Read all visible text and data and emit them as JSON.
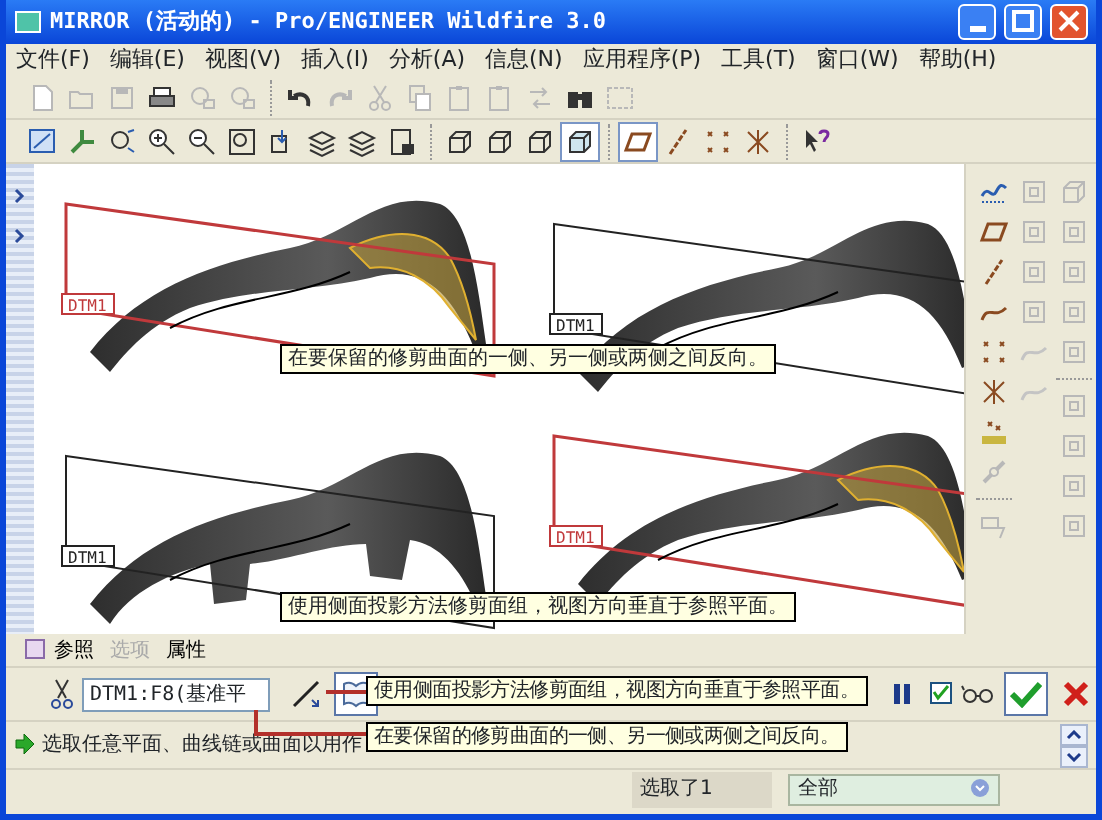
{
  "window": {
    "title": "MIRROR (活动的) - Pro/ENGINEER Wildfire 3.0"
  },
  "menu": [
    "文件(F)",
    "编辑(E)",
    "视图(V)",
    "插入(I)",
    "分析(A)",
    "信息(N)",
    "应用程序(P)",
    "工具(T)",
    "窗口(W)",
    "帮助(H)"
  ],
  "toolbar_1": [
    {
      "kind": "new-file",
      "disabled": true
    },
    {
      "kind": "folder",
      "disabled": true
    },
    {
      "kind": "save",
      "disabled": true
    },
    {
      "kind": "printer",
      "disabled": false
    },
    {
      "kind": "envelope",
      "disabled": true
    },
    {
      "kind": "envelope",
      "disabled": true
    },
    {
      "kind": "sep"
    },
    {
      "kind": "undo",
      "disabled": false
    },
    {
      "kind": "redo",
      "disabled": true
    },
    {
      "kind": "scissors",
      "disabled": true
    },
    {
      "kind": "copy",
      "disabled": true
    },
    {
      "kind": "paste",
      "disabled": true
    },
    {
      "kind": "paste",
      "disabled": true
    },
    {
      "kind": "regenerate",
      "disabled": true
    },
    {
      "kind": "binoculars",
      "disabled": false
    },
    {
      "kind": "selection-box",
      "disabled": true
    }
  ],
  "toolbar_2": [
    {
      "kind": "monitor",
      "selected": false
    },
    {
      "kind": "tripod",
      "selected": false
    },
    {
      "kind": "orient",
      "selected": false
    },
    {
      "kind": "zoom-in",
      "selected": false
    },
    {
      "kind": "zoom-out",
      "selected": false
    },
    {
      "kind": "zoom-fit",
      "selected": false
    },
    {
      "kind": "box-arrow",
      "selected": false
    },
    {
      "kind": "layers",
      "selected": false
    },
    {
      "kind": "layers",
      "selected": false
    },
    {
      "kind": "sheet",
      "selected": false
    },
    {
      "kind": "sep"
    },
    {
      "kind": "cube",
      "selected": false
    },
    {
      "kind": "cube",
      "selected": false
    },
    {
      "kind": "cube",
      "selected": false
    },
    {
      "kind": "cube-shaded",
      "selected": true
    },
    {
      "kind": "sep"
    },
    {
      "kind": "datum-plane",
      "selected": true
    },
    {
      "kind": "datum-axis",
      "selected": false
    },
    {
      "kind": "datum-points",
      "selected": false
    },
    {
      "kind": "csys",
      "selected": false
    },
    {
      "kind": "sep"
    },
    {
      "kind": "help-cursor",
      "selected": false
    }
  ],
  "right_toolbar": [
    [
      {
        "kind": "sketch-curve",
        "disabled": false
      },
      {
        "kind": "datum-plane",
        "disabled": false
      },
      {
        "kind": "datum-axis",
        "disabled": false
      },
      {
        "kind": "curve",
        "disabled": false
      },
      {
        "kind": "datum-points",
        "disabled": false
      },
      {
        "kind": "csys",
        "disabled": false
      },
      {
        "kind": "analysis",
        "disabled": false
      },
      {
        "kind": "chain",
        "disabled": true
      },
      {
        "kind": "sep"
      },
      {
        "kind": "sketch",
        "disabled": true
      }
    ],
    [
      {
        "kind": "generic",
        "disabled": true
      },
      {
        "kind": "generic",
        "disabled": true
      },
      {
        "kind": "generic",
        "disabled": true
      },
      {
        "kind": "generic",
        "disabled": true
      },
      {
        "kind": "curve",
        "disabled": true
      },
      {
        "kind": "curve",
        "disabled": true
      }
    ],
    [
      {
        "kind": "cube",
        "disabled": true
      },
      {
        "kind": "generic",
        "disabled": true
      },
      {
        "kind": "generic",
        "disabled": true
      },
      {
        "kind": "generic",
        "disabled": true
      },
      {
        "kind": "generic",
        "disabled": true
      },
      {
        "kind": "sep"
      },
      {
        "kind": "generic",
        "disabled": true
      },
      {
        "kind": "generic",
        "disabled": true
      },
      {
        "kind": "generic",
        "disabled": true
      },
      {
        "kind": "generic",
        "disabled": true
      }
    ]
  ],
  "canvas": {
    "figures": [
      {
        "kind": "wave",
        "label": "DTM1",
        "highlighted": true
      },
      {
        "kind": "wave",
        "label": "DTM1",
        "highlighted": false
      },
      {
        "kind": "notched",
        "label": "DTM1",
        "highlighted": false
      },
      {
        "kind": "wave",
        "label": "DTM1",
        "highlighted": true
      }
    ],
    "tips": [
      "在要保留的修剪曲面的一侧、另一侧或两侧之间反向。",
      "使用侧面投影方法修剪面组，视图方向垂直于参照平面。"
    ]
  },
  "dashboard": {
    "tabs": [
      {
        "label": "参照",
        "disabled": false
      },
      {
        "label": "选项",
        "disabled": true
      },
      {
        "label": "属性",
        "disabled": false
      }
    ],
    "reference_value": "DTM1:F8(基准平",
    "tips": [
      "使用侧面投影方法修剪面组，视图方向垂直于参照平面。",
      "在要保留的修剪曲面的一侧、另一侧或两侧之间反向。"
    ],
    "preview_checked": true
  },
  "message": "选取任意平面、曲线链或曲面以用作",
  "status_bar": {
    "selection": "选取了1",
    "filter": "全部"
  }
}
